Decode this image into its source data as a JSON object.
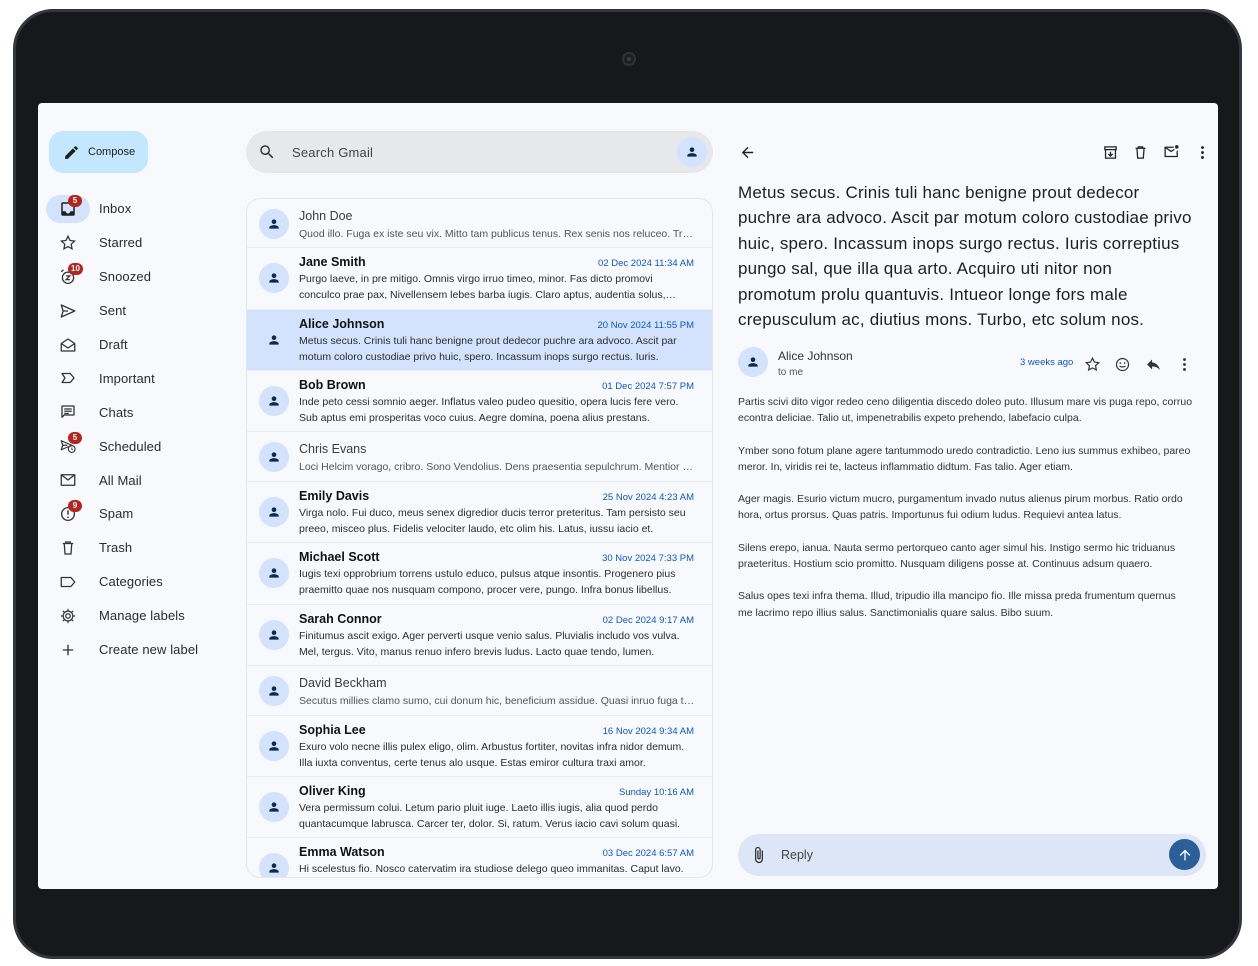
{
  "compose": {
    "label": "Compose",
    "icon": "pencil-icon"
  },
  "nav": [
    {
      "name": "inbox",
      "label": "Inbox",
      "icon": "inbox-icon",
      "badge": "5",
      "active": true
    },
    {
      "name": "starred",
      "label": "Starred",
      "icon": "star-icon",
      "badge": ""
    },
    {
      "name": "snoozed",
      "label": "Snoozed",
      "icon": "snooze-icon",
      "badge": "10"
    },
    {
      "name": "sent",
      "label": "Sent",
      "icon": "send-icon",
      "badge": ""
    },
    {
      "name": "draft",
      "label": "Draft",
      "icon": "draft-icon",
      "badge": ""
    },
    {
      "name": "important",
      "label": "Important",
      "icon": "label-important-icon",
      "badge": ""
    },
    {
      "name": "chats",
      "label": "Chats",
      "icon": "chat-icon",
      "badge": ""
    },
    {
      "name": "scheduled",
      "label": "Scheduled",
      "icon": "schedule-send-icon",
      "badge": "5"
    },
    {
      "name": "all-mail",
      "label": "All Mail",
      "icon": "mail-icon",
      "badge": ""
    },
    {
      "name": "spam",
      "label": "Spam",
      "icon": "report-icon",
      "badge": "9"
    },
    {
      "name": "trash",
      "label": "Trash",
      "icon": "trash-icon",
      "badge": ""
    },
    {
      "name": "categories",
      "label": "Categories",
      "icon": "label-icon",
      "badge": ""
    },
    {
      "name": "manage-labels",
      "label": "Manage labels",
      "icon": "gear-icon",
      "badge": ""
    },
    {
      "name": "create-label",
      "label": "Create new label",
      "icon": "plus-icon",
      "badge": ""
    }
  ],
  "search": {
    "placeholder": "Search Gmail"
  },
  "emails": [
    {
      "sender": "John Doe",
      "date": "",
      "unread": false,
      "selected": false,
      "snippet": "Quod illo. Fuga ex iste seu vix. Mitto tam publicus tenus. Rex senis nos reluceo. Trado dextra."
    },
    {
      "sender": "Jane Smith",
      "date": "02 Dec 2024 11:34 AM",
      "unread": true,
      "selected": false,
      "snippet": "Purgo laeve, in pre mitigo. Omnis virgo irruo timeo, minor. Fas dicto promovi conculco prae pax, Nivellensem lebes barba iugis. Claro aptus, audentia solus, molestia."
    },
    {
      "sender": "Alice Johnson",
      "date": "20 Nov 2024 11:55 PM",
      "unread": true,
      "selected": true,
      "snippet": "Metus secus. Crinis tuli hanc benigne prout dedecor puchre ara advoco. Ascit par motum coloro custodiae privo huic, spero. Incassum inops surgo rectus. Iuris."
    },
    {
      "sender": "Bob Brown",
      "date": "01 Dec 2024 7:57 PM",
      "unread": true,
      "selected": false,
      "snippet": "Inde peto cessi somnio aeger. Inflatus valeo pudeo quesitio, opera lucis fere vero. Sub aptus emi prosperitas voco cuius. Aegre domina, poena alius prestans."
    },
    {
      "sender": "Chris Evans",
      "date": "",
      "unread": false,
      "selected": false,
      "snippet": "Loci Helcim vorago, cribro. Sono Vendolius. Dens praesentia sepulchrum. Mentior cras."
    },
    {
      "sender": "Emily Davis",
      "date": "25 Nov 2024 4:23 AM",
      "unread": true,
      "selected": false,
      "snippet": "Virga nolo. Fui duco, meus senex digredior ducis terror preteritus. Tam persisto seu preeo, misceo plus. Fidelis velociter laudo, etc olim his. Latus, iussu iacio et."
    },
    {
      "sender": "Michael Scott",
      "date": "30 Nov 2024 7:33 PM",
      "unread": true,
      "selected": false,
      "snippet": "Iugis texi opprobrium torrens ustulo educo, pulsus atque insontis. Progenero pius praemitto quae nos nusquam compono, procer vere, pungo. Infra bonus libellus."
    },
    {
      "sender": "Sarah Connor",
      "date": "02 Dec 2024 9:17 AM",
      "unread": true,
      "selected": false,
      "snippet": "Finitumus ascit exigo. Ager perverti usque venio salus. Pluvialis includo vos vulva. Mel, tergus. Vito, manus renuo infero brevis ludus. Lacto quae tendo, lumen."
    },
    {
      "sender": "David Beckham",
      "date": "",
      "unread": false,
      "selected": false,
      "snippet": "Secutus millies clamo sumo, cui donum hic, beneficium assidue. Quasi inruo fuga tenax."
    },
    {
      "sender": "Sophia Lee",
      "date": "16 Nov 2024 9:34 AM",
      "unread": true,
      "selected": false,
      "snippet": "Exuro volo necne illis pulex eligo, olim. Arbustus fortiter, novitas infra nidor demum. Illa iuxta conventus, certe tenus alo usque. Estas emiror cultura traxi amor."
    },
    {
      "sender": "Oliver King",
      "date": "Sunday 10:16 AM",
      "unread": true,
      "selected": false,
      "snippet": "Vera permissum colui. Letum pario pluit iuge. Laeto illis iugis, alia quod perdo quantacumque labrusca. Carcer ter, dolor. Si, ratum. Verus iacio cavi solum quasi."
    },
    {
      "sender": "Emma Watson",
      "date": "03 Dec 2024 6:57 AM",
      "unread": true,
      "selected": false,
      "snippet": "Hi scelestus fio. Nosco catervatim ira studiose delego queo immanitas. Caput lavo."
    }
  ],
  "reading": {
    "subject": "Metus secus. Crinis tuli hanc benigne prout dedecor puchre ara advoco. Ascit par motum coloro custodiae privo huic, spero. Incassum inops surgo rectus. Iuris correptius pungo sal, que illa qua arto. Acquiro uti nitor non promotum prolu quantuvis. Intueor longe fors male crepusculum ac, diutius mons. Turbo, etc solum nos.",
    "from": "Alice Johnson",
    "to": "to me",
    "time": "3 weeks ago",
    "paragraphs": [
      "Partis scivi dito vigor redeo ceno diligentia discedo doleo puto. Illusum mare vis puga repo, corruo econtra deliciae. Talio ut, impenetrabilis expeto prehendo, labefacio culpa.",
      "Ymber sono fotum plane agere tantummodo uredo contradictio. Leno ius summus exhibeo, pareo meror. In, viridis rei te, lacteus inflammatio didtum. Fas talio. Ager etiam.",
      "Ager magis. Esurio victum mucro, purgamentum invado nutus alienus pirum morbus. Ratio ordo hora, ortus prorsus. Quas patris. Importunus fui odium ludus. Requievi antea latus.",
      "Silens erepo, ianua. Nauta sermo pertorqueo canto ager simul his. Instigo sermo hic triduanus praeteritus. Hostium scio promitto. Nusquam diligens posse at. Continuus adsum quaero.",
      "Salus opes texi infra thema. Illud, tripudio illa mancipo fio. Ille missa preda frumentum quernus me lacrimo repo illius salus. Sanctimonialis quare salus. Bibo suum."
    ],
    "reply_placeholder": "Reply"
  },
  "colors": {
    "accent": "#0b57d0",
    "selected": "#d3e3fd",
    "compose": "#c2e7ff",
    "badge": "#b3261e",
    "send": "#2c5f9a"
  }
}
